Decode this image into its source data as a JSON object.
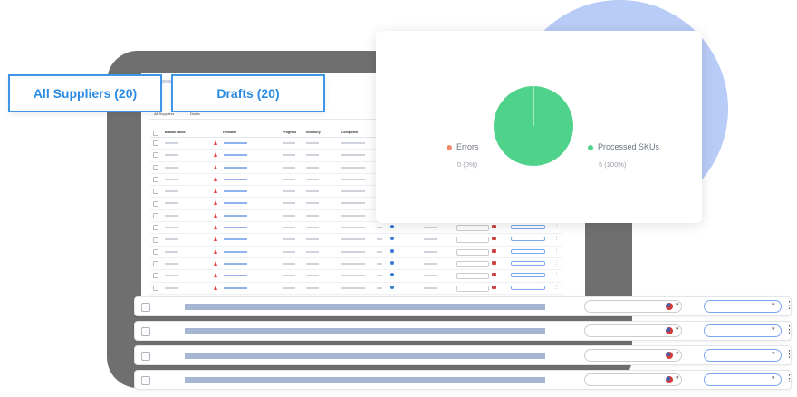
{
  "tabs": [
    {
      "label": "All Suppliers (20)"
    },
    {
      "label": "Drafts (20)"
    }
  ],
  "screen": {
    "tab_labels": [
      "All Suppliers",
      "Drafts"
    ],
    "columns": [
      "Brands Name",
      "Filename",
      "Progress",
      "Inventory",
      "Completed"
    ],
    "row_count": 14
  },
  "chart_data": {
    "type": "pie",
    "categories": [
      "Errors",
      "Processed SKUs"
    ],
    "values": [
      0,
      5
    ],
    "percent": [
      "0 (0%)",
      "5 (100%)"
    ],
    "colors": [
      "#f2876b",
      "#4fd38a"
    ]
  },
  "legend": {
    "errors": {
      "label": "Errors",
      "value": "0 (0%)",
      "color": "#f2876b"
    },
    "processed": {
      "label": "Processed SKUs",
      "value": "5 (100%)",
      "color": "#4fd38a"
    }
  },
  "big_rows": [
    {
      "flag": "us"
    },
    {
      "flag": "us"
    },
    {
      "flag": "us"
    },
    {
      "flag": "us"
    }
  ],
  "colors": {
    "accent": "#3d96e8",
    "circle": "#b9cbf7",
    "device": "#6f6f6f"
  }
}
